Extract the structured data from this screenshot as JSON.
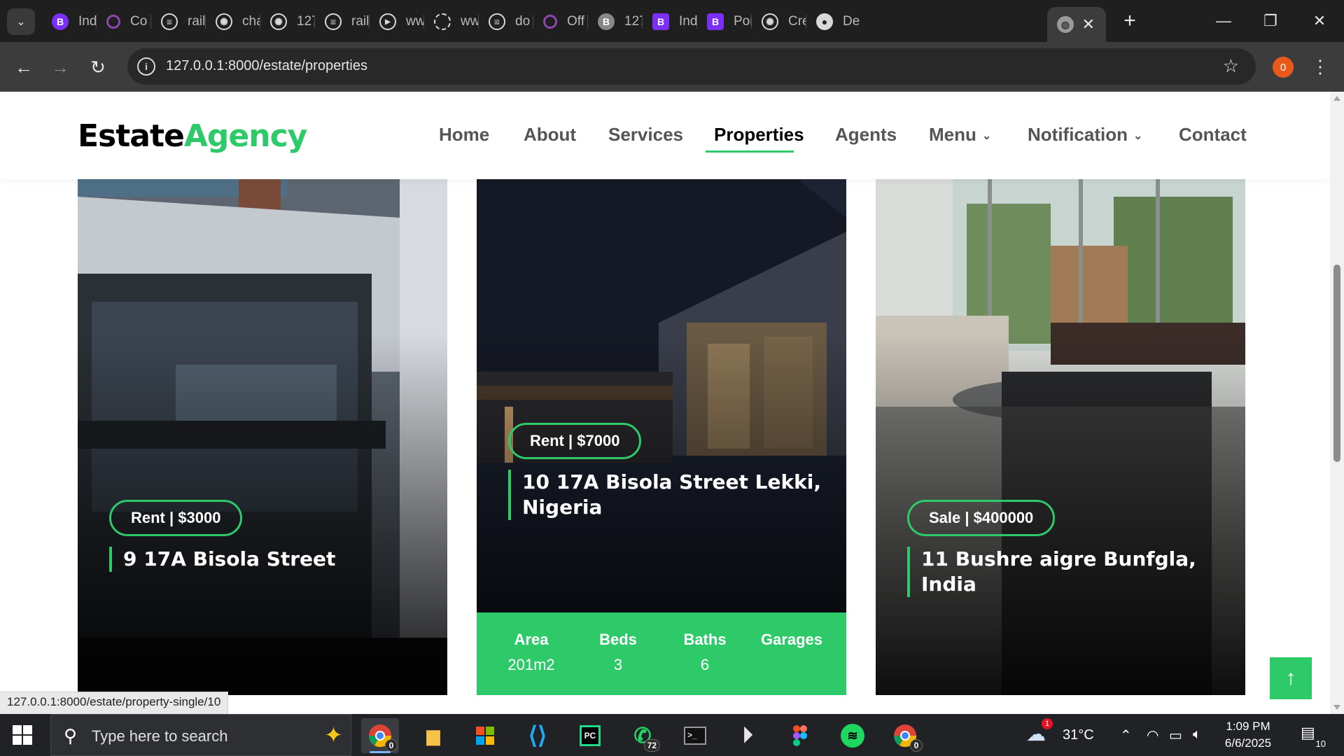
{
  "browser": {
    "tabs": [
      {
        "title": "Ind",
        "icon": "bootstrap-icon",
        "color": "#7b2ff7",
        "glyph": "B"
      },
      {
        "title": "Co",
        "icon": "circle-o-icon",
        "color": "#8e44ad",
        "glyph": "O"
      },
      {
        "title": "rail",
        "icon": "railway-icon",
        "color": "#d8d8d8",
        "glyph": "◉"
      },
      {
        "title": "cha",
        "icon": "openai-icon",
        "color": "#d8d8d8",
        "glyph": "◎"
      },
      {
        "title": "127",
        "icon": "openai-icon",
        "color": "#d8d8d8",
        "glyph": "◎"
      },
      {
        "title": "rail",
        "icon": "railway-icon",
        "color": "#d8d8d8",
        "glyph": "◉"
      },
      {
        "title": "ww",
        "icon": "play-icon",
        "color": "#d8d8d8",
        "glyph": "▶"
      },
      {
        "title": "ww",
        "icon": "loading-icon",
        "color": "#d8d8d8",
        "glyph": "◌"
      },
      {
        "title": "do",
        "icon": "railway-icon",
        "color": "#d8d8d8",
        "glyph": "◉"
      },
      {
        "title": "Off",
        "icon": "circle-o-icon",
        "color": "#8e44ad",
        "glyph": "O"
      },
      {
        "title": "127",
        "icon": "bootstrap-gray-icon",
        "color": "#888888",
        "glyph": "B"
      },
      {
        "title": "Ind",
        "icon": "bootstrap-icon",
        "color": "#7b2ff7",
        "glyph": "B"
      },
      {
        "title": "Por",
        "icon": "bootstrap-icon",
        "color": "#7b2ff7",
        "glyph": "B"
      },
      {
        "title": "Cre",
        "icon": "openai-icon",
        "color": "#d8d8d8",
        "glyph": "◎"
      },
      {
        "title": "De",
        "icon": "github-icon",
        "color": "#d8d8d8",
        "glyph": "●"
      }
    ],
    "active_tab_icon": "globe-icon",
    "url": "127.0.0.1:8000/estate/properties",
    "profile_initial": "0",
    "status_url": "127.0.0.1:8000/estate/property-single/10"
  },
  "site": {
    "logo_part1": "Estate",
    "logo_part2": "Agency",
    "accent": "#2eca6a",
    "nav": [
      {
        "label": "Home"
      },
      {
        "label": "About"
      },
      {
        "label": "Services"
      },
      {
        "label": "Properties",
        "active": true
      },
      {
        "label": "Agents"
      },
      {
        "label": "Menu",
        "dropdown": true
      },
      {
        "label": "Notification",
        "dropdown": true
      },
      {
        "label": "Contact"
      }
    ]
  },
  "properties": [
    {
      "price": "Rent | $3000",
      "title": "9 17A Bisola Street"
    },
    {
      "price": "Rent | $7000",
      "title_line1": "10 17A Bisola Street Lekki,",
      "title_line2": "Nigeria",
      "stats": [
        {
          "label": "Area",
          "value": "201m2"
        },
        {
          "label": "Beds",
          "value": "3"
        },
        {
          "label": "Baths",
          "value": "6"
        },
        {
          "label": "Garages",
          "value": ""
        }
      ]
    },
    {
      "price": "Sale | $400000",
      "title": "11 Bushre aigre Bunfgla, India"
    }
  ],
  "taskbar": {
    "search_placeholder": "Type here to search",
    "apps": [
      {
        "name": "chrome",
        "badge": "0"
      },
      {
        "name": "file-explorer"
      },
      {
        "name": "microsoft-store"
      },
      {
        "name": "vscode"
      },
      {
        "name": "pycharm"
      },
      {
        "name": "whatsapp",
        "badge": "72"
      },
      {
        "name": "terminal"
      },
      {
        "name": "media-player"
      },
      {
        "name": "figma"
      },
      {
        "name": "spotify"
      },
      {
        "name": "chrome-profile",
        "badge": "0"
      }
    ],
    "weather_alert": "1",
    "temperature": "31°C",
    "time": "1:09 PM",
    "date": "6/6/2025",
    "notifications": "10"
  }
}
